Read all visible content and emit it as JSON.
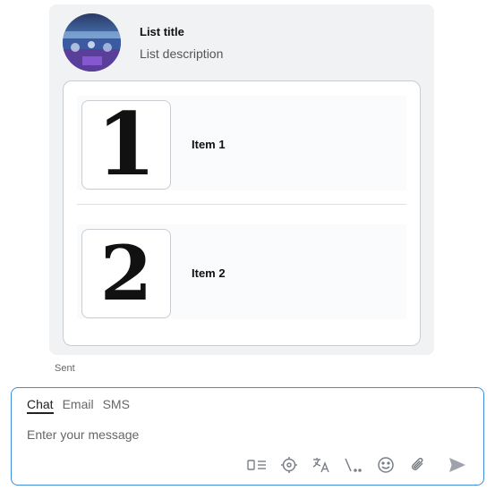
{
  "card": {
    "title": "List title",
    "description": "List description",
    "items": [
      {
        "thumb_text": "1",
        "label": "Item 1"
      },
      {
        "thumb_text": "2",
        "label": "Item 2"
      }
    ]
  },
  "status": "Sent",
  "composer": {
    "tabs": [
      {
        "label": "Chat",
        "active": true
      },
      {
        "label": "Email",
        "active": false
      },
      {
        "label": "SMS",
        "active": false
      }
    ],
    "placeholder": "Enter your message",
    "tools": [
      "canned-responses-icon",
      "location-icon",
      "translate-icon",
      "signature-icon",
      "emoji-icon",
      "attachment-icon",
      "send-icon"
    ]
  },
  "colors": {
    "card_bg": "#f1f2f4",
    "composer_border": "#3f8ddb",
    "icon": "#7a7f87"
  }
}
